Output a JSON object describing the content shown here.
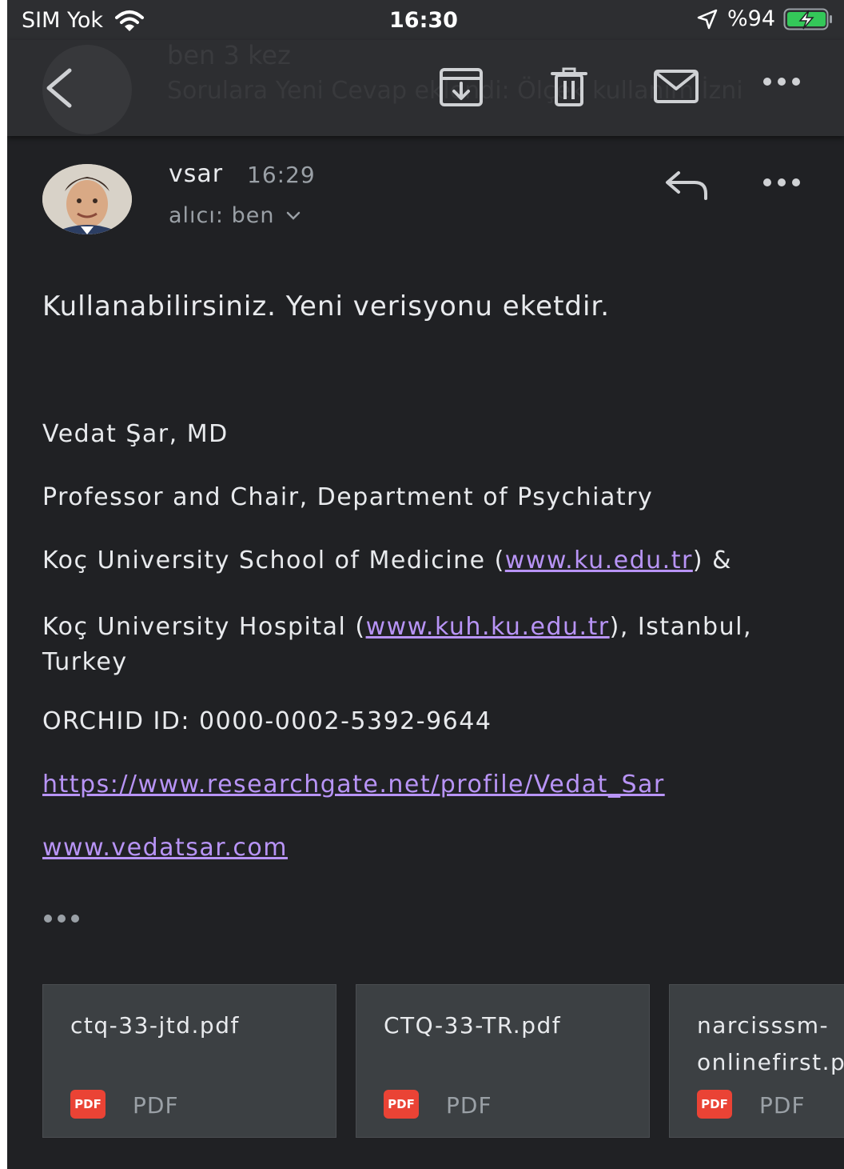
{
  "status_bar": {
    "carrier": "SIM Yok",
    "time": "16:30",
    "battery": "%94"
  },
  "toolbar": {
    "ghost_sender": "ben  3 kez",
    "ghost_subject": "Sorulara Yeni Cevap eklendi: Ölçek kullanım İzni"
  },
  "message": {
    "sender": "vsar",
    "time": "16:29",
    "recipient": "alıcı: ben",
    "body": "Kullanabilirsiniz. Yeni verisyonu eketdir."
  },
  "signature": {
    "name": "Vedat Şar, MD",
    "title": "Professor and Chair, Department of Psychiatry",
    "line3_prefix": "Koç University School of Medicine (",
    "line3_link": "www.ku.edu.tr",
    "line3_suffix": ") &",
    "line4_prefix": "Koç University Hospital (",
    "line4_link": "www.kuh.ku.edu.tr",
    "line4_suffix": "), Istanbul,",
    "line4_cont": "Turkey",
    "orchid": "ORCHID ID: 0000-0002-5392-9644",
    "researchgate": "https://www.researchgate.net/profile/Vedat_Sar",
    "website": "www.vedatsar.com"
  },
  "attachments": [
    {
      "name": "ctq-33-jtd.pdf",
      "badge": "PDF",
      "type": "PDF"
    },
    {
      "name": "CTQ-33-TR.pdf",
      "badge": "PDF",
      "type": "PDF"
    },
    {
      "name": "narcisssm-\nonlinefirst.pdf",
      "badge": "PDF",
      "type": "PDF"
    }
  ],
  "colors": {
    "background": "#202124",
    "toolbar": "#2d2e31",
    "link": "#b894f6",
    "pdf_badge": "#ea4335",
    "battery": "#34c759"
  }
}
